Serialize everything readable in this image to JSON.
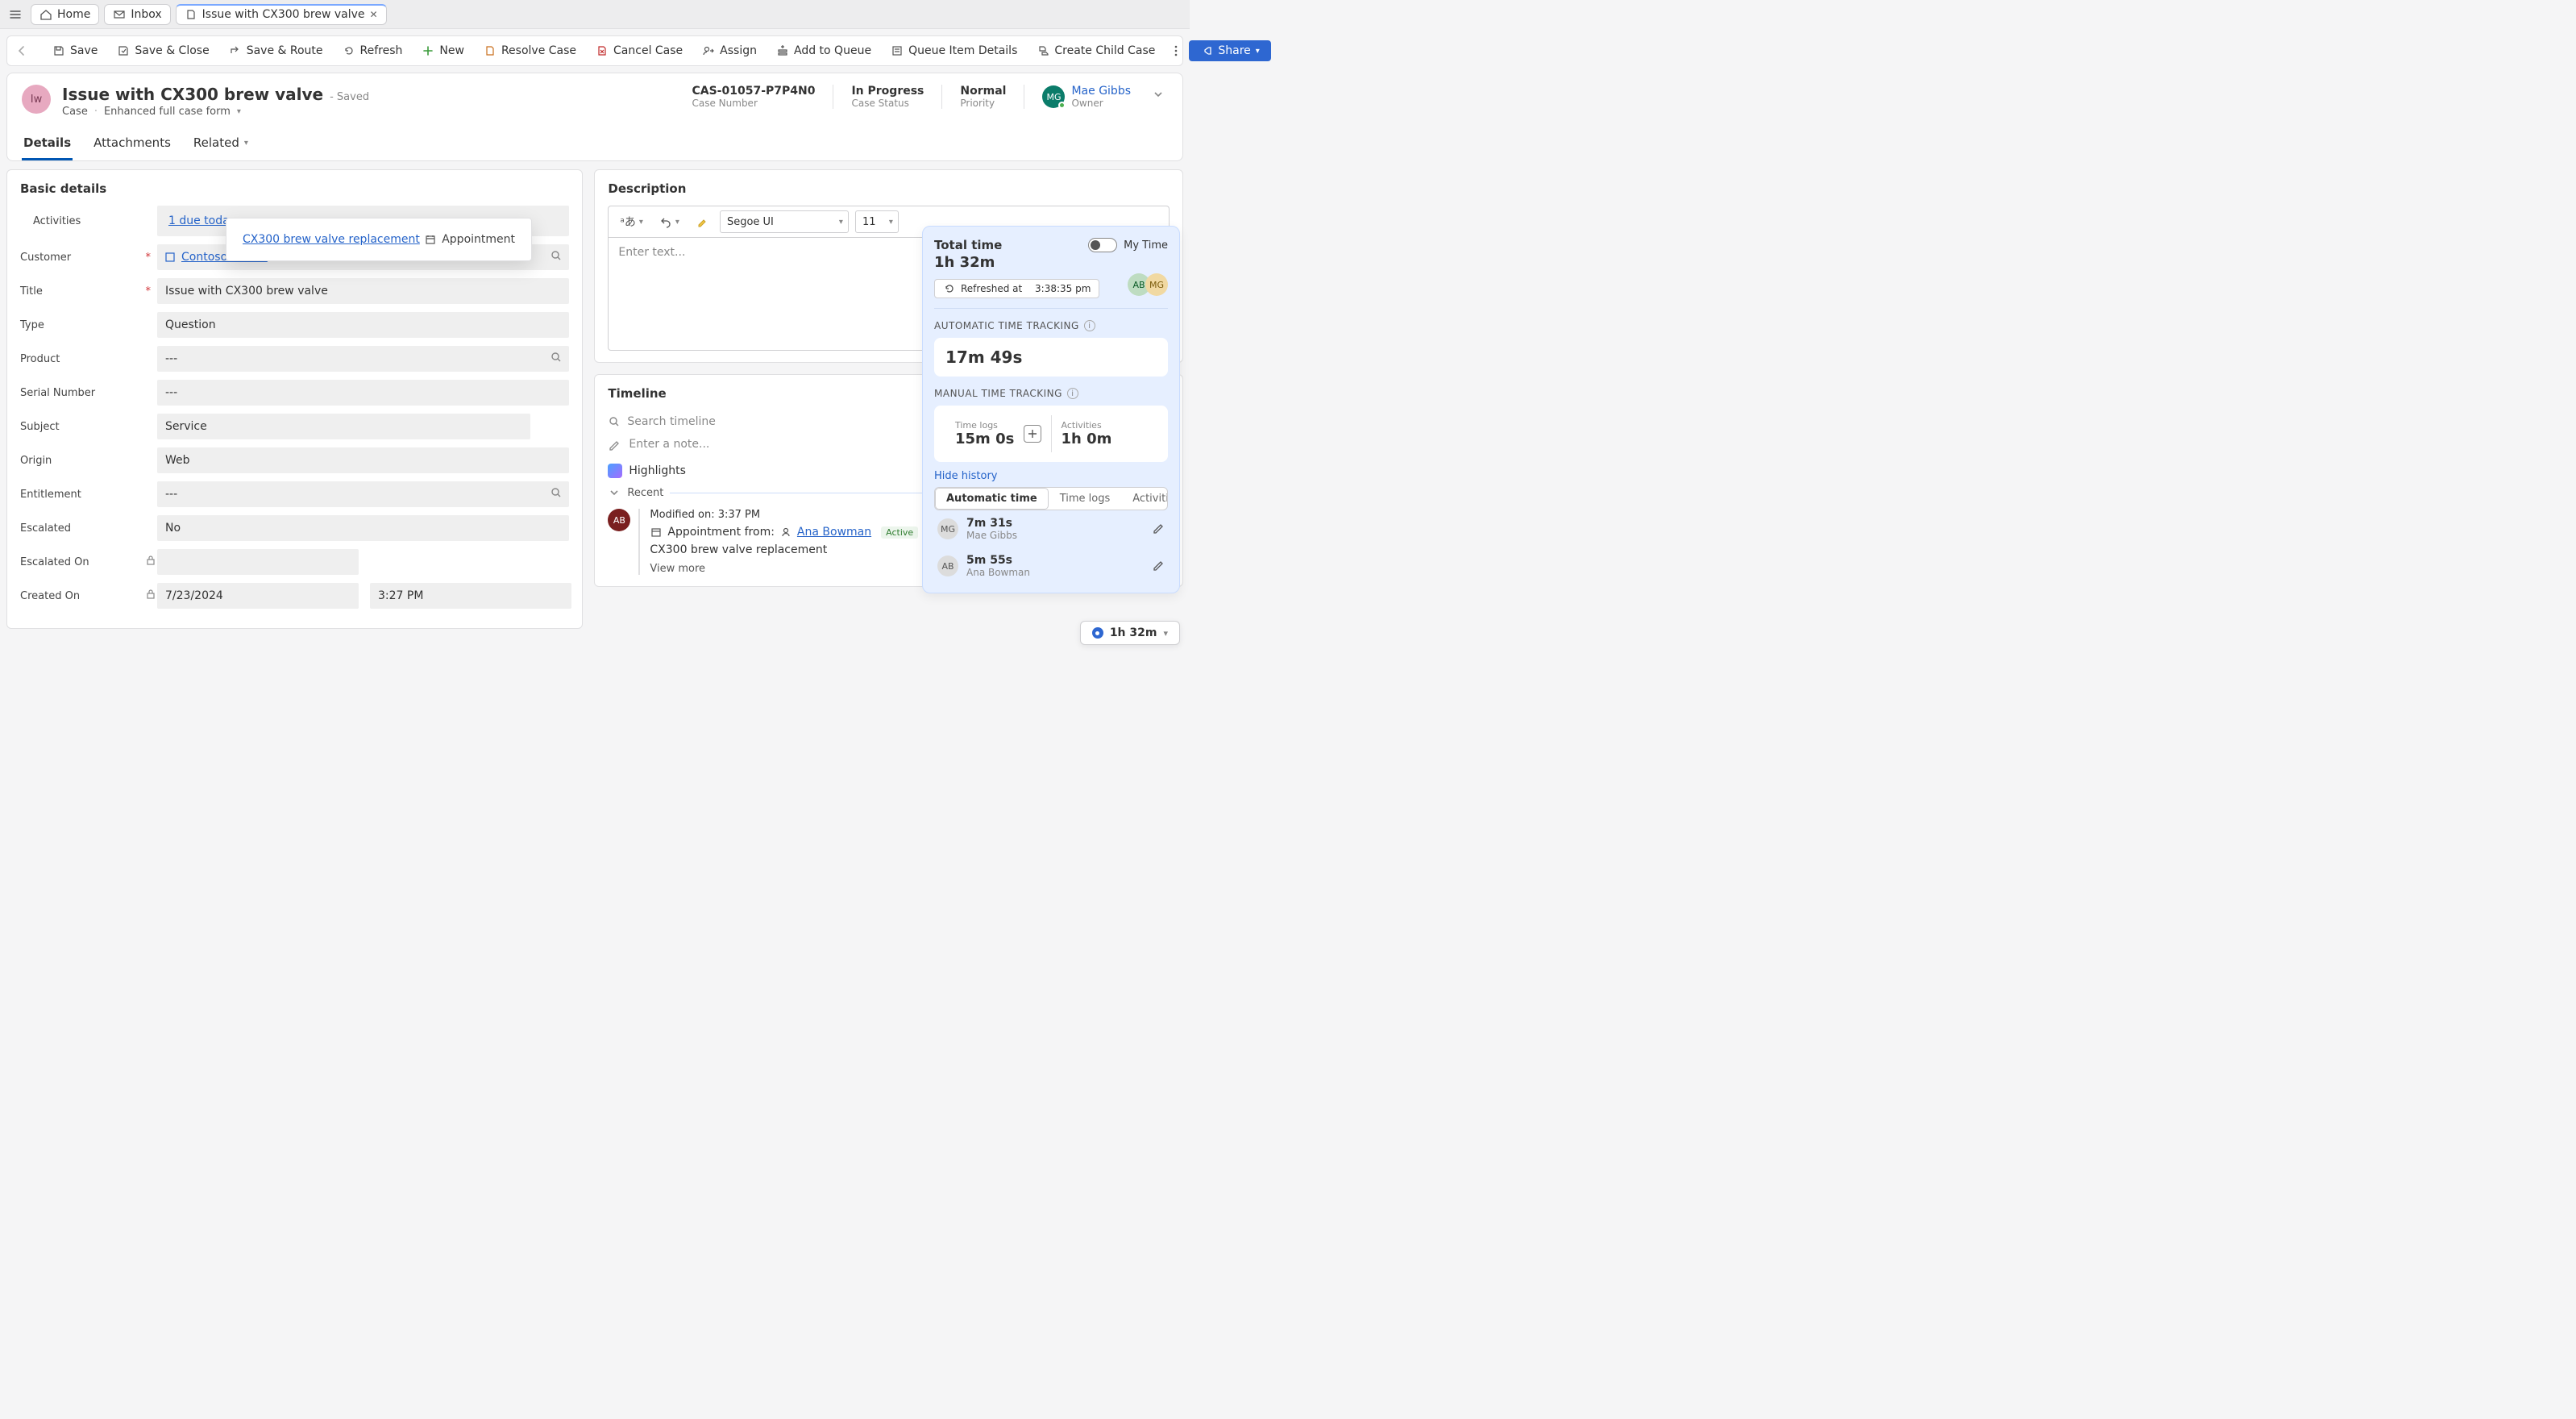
{
  "tabstrip": {
    "home": "Home",
    "inbox": "Inbox",
    "case_tab": "Issue with CX300 brew valve"
  },
  "commands": {
    "save": "Save",
    "save_close": "Save & Close",
    "save_route": "Save & Route",
    "refresh": "Refresh",
    "new": "New",
    "resolve": "Resolve Case",
    "cancel": "Cancel Case",
    "assign": "Assign",
    "add_queue": "Add to Queue",
    "queue_details": "Queue Item Details",
    "create_child": "Create Child Case",
    "share": "Share"
  },
  "header": {
    "avatar_initials": "Iw",
    "title": "Issue with CX300 brew valve",
    "saved_suffix": "- Saved",
    "entity": "Case",
    "form_name": "Enhanced full case form",
    "case_number": {
      "value": "CAS-01057-P7P4N0",
      "label": "Case Number"
    },
    "status": {
      "value": "In Progress",
      "label": "Case Status"
    },
    "priority": {
      "value": "Normal",
      "label": "Priority"
    },
    "owner": {
      "initials": "MG",
      "name": "Mae Gibbs",
      "label": "Owner"
    }
  },
  "formtabs": {
    "details": "Details",
    "attachments": "Attachments",
    "related": "Related"
  },
  "basic": {
    "section_title": "Basic details",
    "activities_label": "Activities",
    "activities_link": "1 due today",
    "customer_label": "Customer",
    "customer_value": "Contoso Coffee",
    "title_label": "Title",
    "title_value": "Issue with CX300 brew valve",
    "type_label": "Type",
    "type_value": "Question",
    "product_label": "Product",
    "product_value": "---",
    "serial_label": "Serial Number",
    "serial_value": "---",
    "subject_label": "Subject",
    "subject_value": "Service",
    "origin_label": "Origin",
    "origin_value": "Web",
    "entitlement_label": "Entitlement",
    "entitlement_value": "---",
    "escalated_label": "Escalated",
    "escalated_value": "No",
    "escalated_on_label": "Escalated On",
    "escalated_on_value": "",
    "created_on_label": "Created On",
    "created_on_date": "7/23/2024",
    "created_on_time": "3:27 PM"
  },
  "flyout": {
    "link": "CX300 brew valve replacement",
    "type": "Appointment"
  },
  "description": {
    "heading": "Description",
    "font_value": "Segoe UI",
    "size_value": "11",
    "placeholder": "Enter text..."
  },
  "timeline": {
    "heading": "Timeline",
    "search_placeholder": "Search timeline",
    "note_placeholder": "Enter a note...",
    "highlights": "Highlights",
    "recent_label": "Recent",
    "item": {
      "avatar": "AB",
      "modified": "Modified on: 3:37 PM",
      "line_prefix": "Appointment from:",
      "person": "Ana Bowman",
      "status": "Active",
      "subject": "CX300 brew valve replacement",
      "view_more": "View more"
    }
  },
  "time": {
    "total_label": "Total time",
    "total_value": "1h 32m",
    "my_time_label": "My Time",
    "refreshed_prefix": "Refreshed at",
    "refreshed_time": "3:38:35 pm",
    "auto_label": "AUTOMATIC TIME TRACKING",
    "auto_value": "17m 49s",
    "manual_label": "MANUAL TIME TRACKING",
    "timelogs_label": "Time logs",
    "timelogs_value": "15m 0s",
    "activities_label": "Activities",
    "activities_value": "1h 0m",
    "hide_history": "Hide history",
    "seg_auto": "Automatic time",
    "seg_logs": "Time logs",
    "seg_acts": "Activities",
    "history": [
      {
        "initials": "MG",
        "duration": "7m 31s",
        "name": "Mae Gibbs"
      },
      {
        "initials": "AB",
        "duration": "5m 55s",
        "name": "Ana Bowman"
      }
    ],
    "pill_value": "1h 32m",
    "av1": "AB",
    "av2": "MG"
  }
}
